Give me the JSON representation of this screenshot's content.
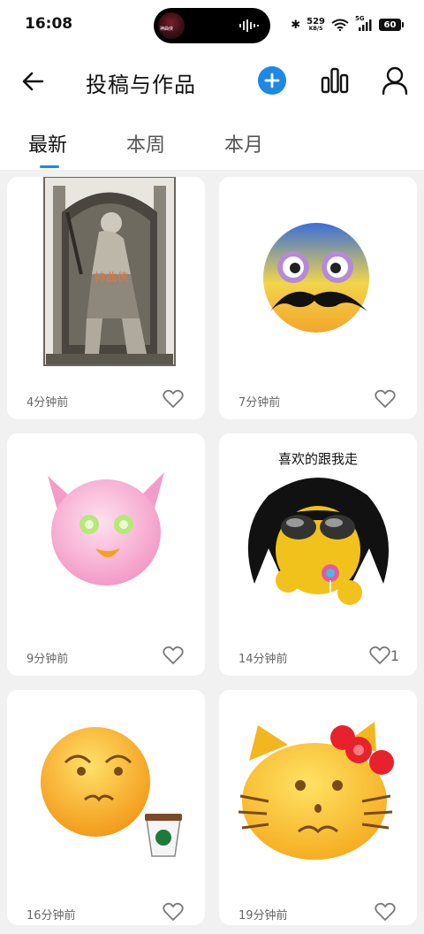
{
  "status_bar": {
    "time": "16:08",
    "island_thumb_text": "神曲侠",
    "bluetooth": "✱",
    "net_speed": "529",
    "net_unit": "KB/S",
    "network": "5G",
    "battery": "60"
  },
  "header": {
    "title": "投稿与作品"
  },
  "tabs": [
    {
      "label": "最新",
      "active": true
    },
    {
      "label": "本周",
      "active": false
    },
    {
      "label": "本月",
      "active": false
    }
  ],
  "posts": [
    {
      "time": "4分钟前",
      "likes": "",
      "watermark": "神曲侠"
    },
    {
      "time": "7分钟前",
      "likes": ""
    },
    {
      "time": "9分钟前",
      "likes": ""
    },
    {
      "time": "14分钟前",
      "likes": "1",
      "caption": "喜欢的跟我走"
    },
    {
      "time": "16分钟前",
      "likes": ""
    },
    {
      "time": "19分钟前",
      "likes": ""
    }
  ],
  "colors": {
    "accent": "#1e88e5",
    "background": "#f1f1f1"
  }
}
